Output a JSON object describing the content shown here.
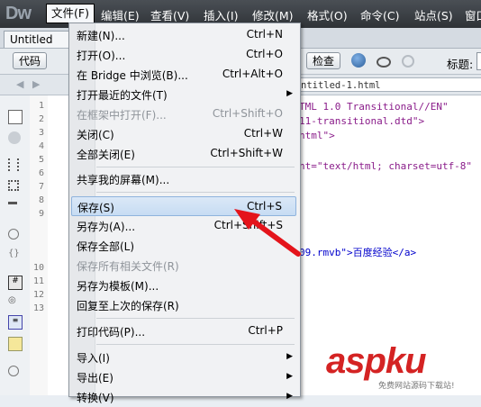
{
  "app": {
    "logo": "Dw",
    "menubar": [
      "文件(F)",
      "编辑(E)",
      "查看(V)",
      "插入(I)",
      "修改(M)",
      "格式(O)",
      "命令(C)",
      "站点(S)",
      "窗口"
    ]
  },
  "document": {
    "tab_title": "Untitled",
    "toolbar": {
      "code_button": "代码",
      "check_button": "检查",
      "title_label": "标题:"
    },
    "address": "ntitled-1.html",
    "line_numbers": [
      "1",
      "2",
      "3",
      "4",
      "5",
      "6",
      "7",
      "8",
      "9",
      "10",
      "11",
      "12",
      "13"
    ],
    "code_lines": [
      "TML 1.0 Transitional//EN\"",
      "11-transitional.dtd\">",
      "html\">",
      "",
      "",
      "nt=\"text/html; charset=utf-8\"",
      "",
      "",
      "",
      "",
      "09.rmvb\">百度经验</a>"
    ]
  },
  "file_menu": {
    "items": [
      {
        "label": "新建(N)...",
        "shortcut": "Ctrl+N",
        "disabled": false
      },
      {
        "label": "打开(O)...",
        "shortcut": "Ctrl+O",
        "disabled": false
      },
      {
        "label": "在 Bridge 中浏览(B)...",
        "shortcut": "Ctrl+Alt+O",
        "disabled": false
      },
      {
        "label": "打开最近的文件(T)",
        "shortcut": "",
        "submenu": true,
        "disabled": false
      },
      {
        "label": "在框架中打开(F)...",
        "shortcut": "Ctrl+Shift+O",
        "disabled": true
      },
      {
        "label": "关闭(C)",
        "shortcut": "Ctrl+W",
        "disabled": false
      },
      {
        "label": "全部关闭(E)",
        "shortcut": "Ctrl+Shift+W",
        "disabled": false
      },
      {
        "label": "共享我的屏幕(M)...",
        "shortcut": "",
        "disabled": false
      },
      {
        "label": "保存(S)",
        "shortcut": "Ctrl+S",
        "disabled": false,
        "highlighted": true
      },
      {
        "label": "另存为(A)...",
        "shortcut": "Ctrl+Shift+S",
        "disabled": false
      },
      {
        "label": "保存全部(L)",
        "shortcut": "",
        "disabled": false
      },
      {
        "label": "保存所有相关文件(R)",
        "shortcut": "",
        "disabled": true
      },
      {
        "label": "另存为模板(M)...",
        "shortcut": "",
        "disabled": false
      },
      {
        "label": "回复至上次的保存(R)",
        "shortcut": "",
        "disabled": false
      },
      {
        "label": "打印代码(P)...",
        "shortcut": "Ctrl+P",
        "disabled": false
      },
      {
        "label": "导入(I)",
        "shortcut": "",
        "submenu": true,
        "disabled": false
      },
      {
        "label": "导出(E)",
        "shortcut": "",
        "submenu": true,
        "disabled": false
      },
      {
        "label": "转换(V)",
        "shortcut": "",
        "submenu": true,
        "disabled": false
      }
    ]
  },
  "watermark": {
    "logo": "aspku",
    "subtitle": "免费网站源码下载站!"
  },
  "colors": {
    "annotation_arrow": "#e4141b",
    "menu_highlight": "#c7dcf3",
    "watermark": "#d42323"
  }
}
